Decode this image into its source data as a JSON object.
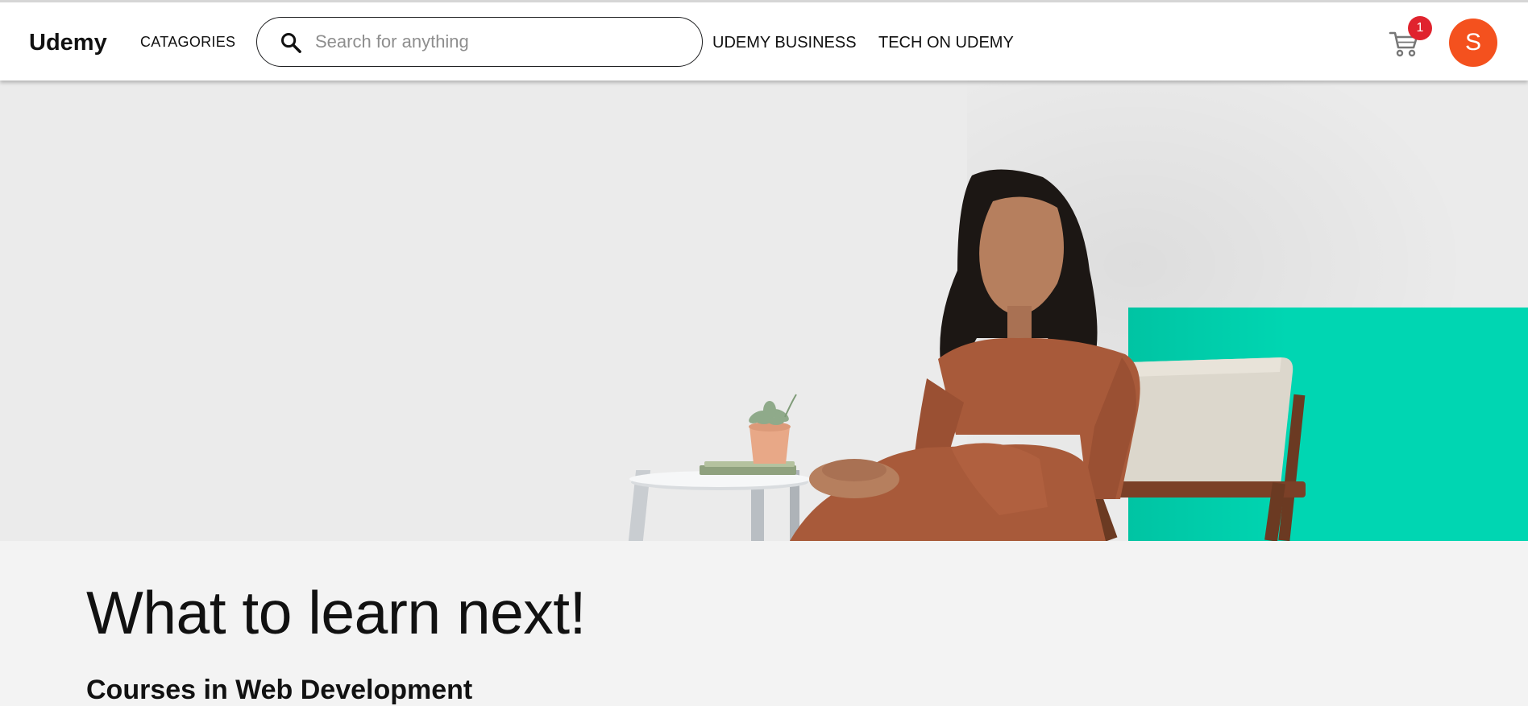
{
  "brand": {
    "logo": "Udemy"
  },
  "nav": {
    "categories": "CATAGORIES",
    "business": "UDEMY BUSINESS",
    "tech": "TECH ON UDEMY"
  },
  "search": {
    "placeholder": "Search for anything",
    "value": ""
  },
  "cart": {
    "count": "1",
    "icon": "cart-icon"
  },
  "user": {
    "initial": "S"
  },
  "colors": {
    "accent_teal": "#00d6b2",
    "avatar": "#f4511e",
    "badge": "#e0232e"
  },
  "main": {
    "title": "What to learn next!",
    "subtitle": "Courses in Web Development"
  }
}
